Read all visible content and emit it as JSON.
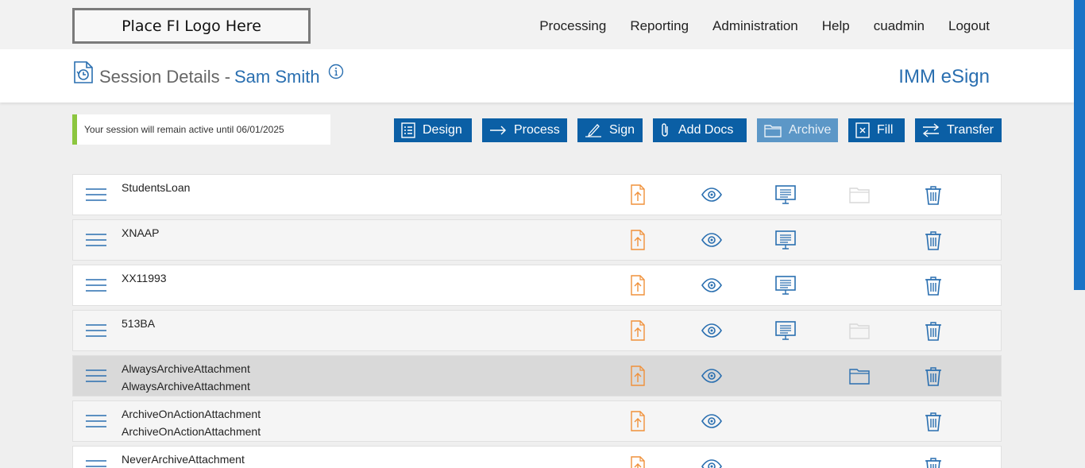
{
  "logo": {
    "text": "Place FI Logo Here"
  },
  "nav": [
    "Processing",
    "Reporting",
    "Administration",
    "Help",
    "cuadmin",
    "Logout"
  ],
  "header": {
    "title": "Session Details -",
    "name": "Sam Smith",
    "brand": "IMM eSign"
  },
  "notice": {
    "text": "Your session will remain active until 06/01/2025"
  },
  "toolbar": {
    "design": "Design",
    "process": "Process",
    "sign": "Sign",
    "add_docs": "Add Docs",
    "archive": "Archive",
    "fill": "Fill",
    "transfer": "Transfer"
  },
  "rows": [
    {
      "name": "StudentsLoan",
      "subname": "",
      "present": true,
      "folder": "faded"
    },
    {
      "name": "XNAAP",
      "subname": "",
      "present": true,
      "folder": "none"
    },
    {
      "name": "XX11993",
      "subname": "",
      "present": true,
      "folder": "none"
    },
    {
      "name": "513BA",
      "subname": "",
      "present": true,
      "folder": "faded"
    },
    {
      "name": "AlwaysArchiveAttachment",
      "subname": "AlwaysArchiveAttachment",
      "present": false,
      "folder": "active"
    },
    {
      "name": "ArchiveOnActionAttachment",
      "subname": "ArchiveOnActionAttachment",
      "present": false,
      "folder": "none"
    },
    {
      "name": "NeverArchiveAttachment",
      "subname": "",
      "present": false,
      "folder": "none"
    }
  ],
  "colors": {
    "brand_blue": "#0b5fa5",
    "link_blue": "#2a6fb0",
    "upload_orange": "#f0913a",
    "notice_green": "#8cc63f"
  }
}
